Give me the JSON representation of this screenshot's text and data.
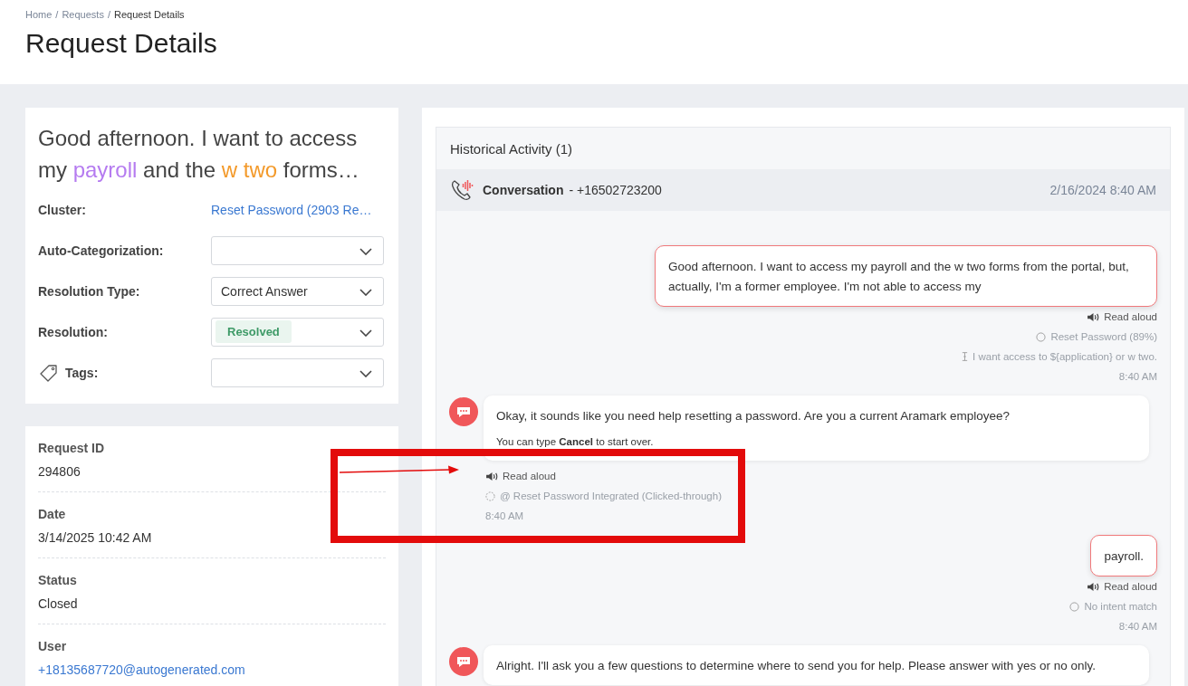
{
  "breadcrumb": [
    {
      "label": "Home",
      "current": false
    },
    {
      "label": "Requests",
      "current": false,
      "separator": "/"
    },
    {
      "label": "Request Details",
      "current": true,
      "separator": "/"
    }
  ],
  "page_title": "Request Details",
  "summary": {
    "headline": [
      {
        "text": "Good afternoon. I want to access my "
      },
      {
        "text": "payroll",
        "color": "#b57bf0"
      },
      {
        "text": " and the "
      },
      {
        "text": "w two",
        "color": "#f39a2b"
      },
      {
        "text": " forms…"
      }
    ],
    "fields": [
      {
        "kind": "link",
        "label": "Cluster:",
        "value": "Reset Password (2903 Re…"
      },
      {
        "kind": "select",
        "label": "Auto-Categorization:"
      },
      {
        "kind": "select",
        "label": "Resolution Type:",
        "value": "Correct Answer"
      },
      {
        "kind": "badge-select",
        "label": "Resolution:",
        "value": "Resolved"
      },
      {
        "kind": "tag-select",
        "label": "Tags:"
      }
    ]
  },
  "details": [
    {
      "kind": "text",
      "label": "Request ID",
      "value": "294806"
    },
    {
      "kind": "text",
      "label": "Date",
      "value": "3/14/2025 10:42 AM"
    },
    {
      "kind": "text",
      "label": "Status",
      "value": "Closed"
    },
    {
      "kind": "link",
      "label": "User",
      "value": "+18135687720@autogenerated.com"
    }
  ],
  "activity": {
    "title": "Historical Activity (1)",
    "conversation": {
      "label": "Conversation",
      "number": "- +16502723200",
      "date": "2/16/2024 8:40 AM"
    },
    "messages": [
      {
        "kind": "user",
        "text": [
          "Good afternoon. I want to access my payroll and the w two forms from the portal, but, actually, I'm a former employee. I'm not able to access my"
        ],
        "meta": [
          {
            "kind": "read-aloud",
            "text": "Read aloud"
          },
          {
            "kind": "intent",
            "text": "Reset Password (89%)"
          },
          {
            "kind": "match",
            "text": "I want access to ${application} or w two."
          },
          {
            "kind": "time",
            "text": "8:40 AM"
          }
        ]
      },
      {
        "kind": "bot",
        "text": [
          "Okay, it sounds like you need help resetting a password. Are you a current Aramark employee?",
          "You can type **Cancel** to start over."
        ],
        "meta": [
          {
            "kind": "read-aloud",
            "text": "Read aloud"
          },
          {
            "kind": "intent-dashed",
            "text": "@ Reset Password Integrated (Clicked-through)"
          },
          {
            "kind": "time",
            "text": "8:40 AM"
          }
        ]
      },
      {
        "kind": "user",
        "text": [
          "payroll."
        ],
        "meta": [
          {
            "kind": "read-aloud",
            "text": "Read aloud"
          },
          {
            "kind": "intent",
            "text": "No intent match"
          },
          {
            "kind": "time",
            "text": "8:40 AM"
          }
        ]
      },
      {
        "kind": "bot",
        "text": [
          "Alright. I'll ask you a few questions to determine where to send you for help. Please answer with yes or no only."
        ]
      }
    ]
  }
}
